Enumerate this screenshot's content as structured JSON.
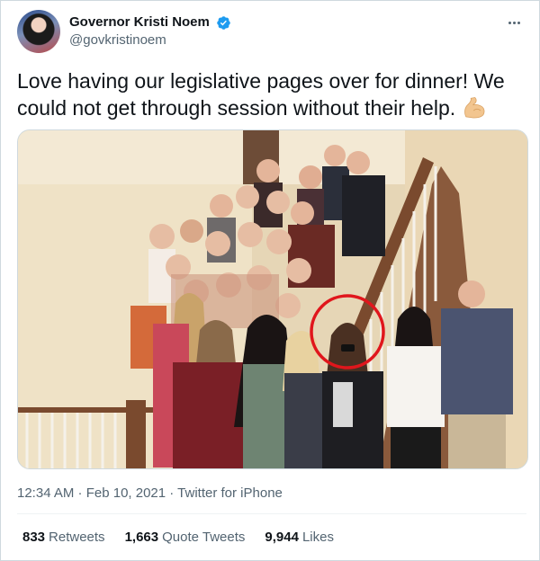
{
  "user": {
    "display_name": "Governor Kristi Noem",
    "handle": "@govkristinoem",
    "verified": true
  },
  "tweet": {
    "text": "Love having our legislative pages over for dinner! We could not get through session without their help.",
    "emoji": "flexed-biceps",
    "timestamp": "12:34 AM · Feb 10, 2021 · Twitter for iPhone"
  },
  "stats": {
    "retweets_count": "833",
    "retweets_label": "Retweets",
    "quote_count": "1,663",
    "quote_label": "Quote Tweets",
    "likes_count": "9,944",
    "likes_label": "Likes"
  },
  "colors": {
    "verified_blue": "#1d9bf0",
    "secondary_text": "#536471",
    "highlight_circle": "#e0161c"
  },
  "icons": [
    "more-icon",
    "verified-badge-icon",
    "flexed-biceps-emoji"
  ]
}
